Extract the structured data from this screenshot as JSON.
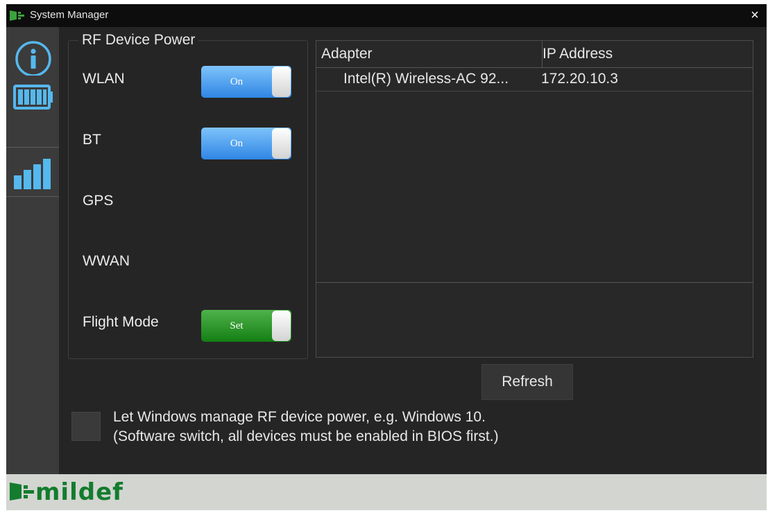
{
  "window": {
    "title": "System Manager",
    "close_glyph": "×"
  },
  "sidebar": {
    "items": [
      {
        "icon": "info-icon"
      },
      {
        "icon": "battery-icon"
      },
      {
        "icon": "signal-icon"
      }
    ]
  },
  "rf_panel": {
    "title": "RF Device Power",
    "rows": [
      {
        "label": "WLAN",
        "toggle": "On",
        "color": "#2f86e4"
      },
      {
        "label": "BT",
        "toggle": "On",
        "color": "#2f86e4"
      },
      {
        "label": "GPS"
      },
      {
        "label": "WWAN"
      },
      {
        "label": "Flight Mode",
        "toggle": "Set",
        "color": "#137f14"
      }
    ]
  },
  "adapter_table": {
    "columns": [
      "Adapter",
      "IP Address"
    ],
    "rows": [
      {
        "adapter": "Intel(R) Wireless-AC 92...",
        "ip": "172.20.10.3"
      }
    ]
  },
  "refresh_label": "Refresh",
  "windows_manage": {
    "line1": "Let Windows manage RF device power, e.g. Windows 10.",
    "line2": "(Software switch, all devices must be enabled in BIOS first.)"
  },
  "brand": {
    "text": "mildef",
    "color": "#137c2e"
  }
}
